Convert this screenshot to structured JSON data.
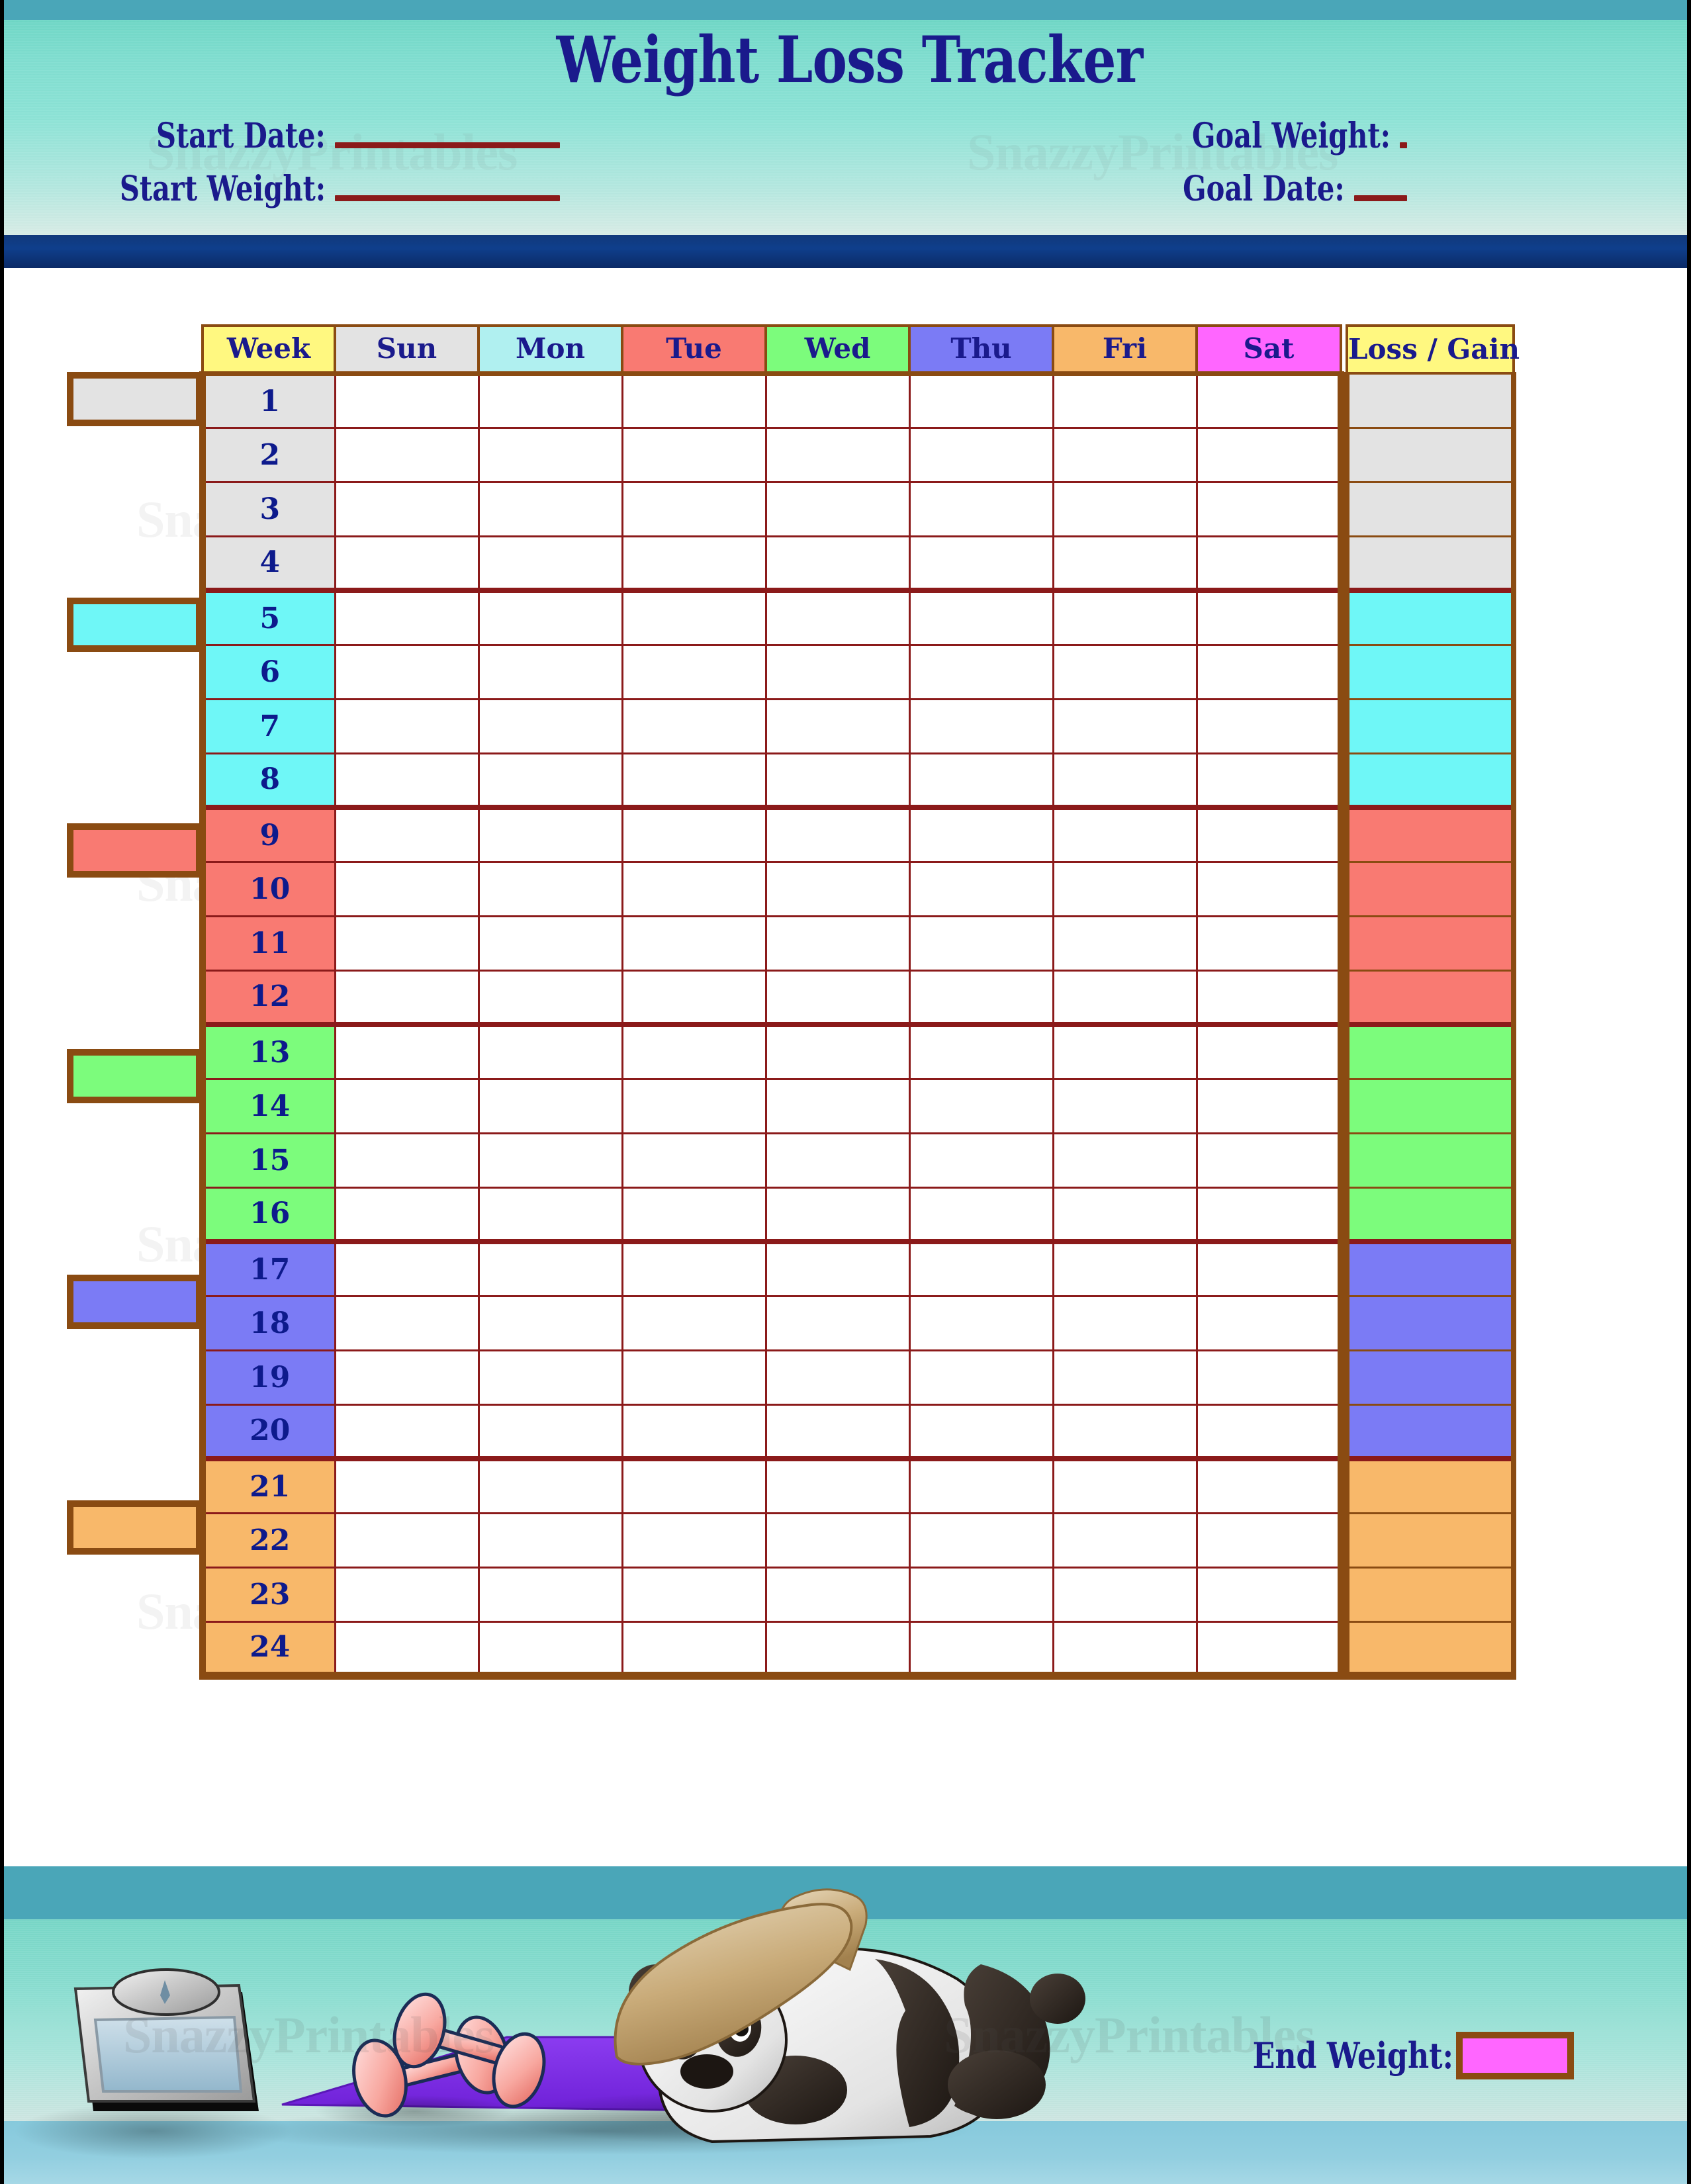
{
  "header": {
    "title": "Weight Loss Tracker",
    "fields": [
      {
        "label": "Start Date:"
      },
      {
        "label": "Start Weight:"
      },
      {
        "label": "Goal Weight:"
      },
      {
        "label": "Goal Date:"
      }
    ]
  },
  "watermark": {
    "text": "SnazzyPrintables"
  },
  "table": {
    "headers": [
      "Week",
      "Sun",
      "Mon",
      "Tue",
      "Wed",
      "Thu",
      "Fri",
      "Sat"
    ],
    "loss_gain_header": "Loss / Gain",
    "header_colors": {
      "week": "#FFF880",
      "sun": "#E3E3E3",
      "mon": "#B0F0F0",
      "tue": "#F97A72",
      "wed": "#7CFC7C",
      "thu": "#7B7BF5",
      "fri": "#F8B86A",
      "sat": "#FF66FF",
      "loss_gain": "#FFF880"
    },
    "group_colors": [
      "#E3E3E3",
      "#6FF7F7",
      "#F97A72",
      "#7CFC7C",
      "#7B7BF5",
      "#F8B86A"
    ],
    "weeks": [
      1,
      2,
      3,
      4,
      5,
      6,
      7,
      8,
      9,
      10,
      11,
      12,
      13,
      14,
      15,
      16,
      17,
      18,
      19,
      20,
      21,
      22,
      23,
      24
    ],
    "groups": [
      {
        "weeks": [
          1,
          2,
          3,
          4
        ],
        "color": "#E3E3E3"
      },
      {
        "weeks": [
          5,
          6,
          7,
          8
        ],
        "color": "#6FF7F7"
      },
      {
        "weeks": [
          9,
          10,
          11,
          12
        ],
        "color": "#F97A72"
      },
      {
        "weeks": [
          13,
          14,
          15,
          16
        ],
        "color": "#7CFC7C"
      },
      {
        "weeks": [
          17,
          18,
          19,
          20
        ],
        "color": "#7B7BF5"
      },
      {
        "weeks": [
          21,
          22,
          23,
          24
        ],
        "color": "#F8B86A"
      }
    ],
    "border_color": "#8a4b12",
    "grid_color": "#8b1a1a"
  },
  "footer": {
    "end_weight_label": "End Weight:",
    "end_weight_box_color": "#FF66FF",
    "illustration": [
      "bathroom-scale",
      "pink-dumbbells",
      "purple-yoga-mat",
      "panda-with-hat"
    ]
  },
  "colors": {
    "navy_text": "#1a1a8c",
    "blue_bar": "#0f3f8c",
    "teal_band": "#4aa6b8"
  }
}
